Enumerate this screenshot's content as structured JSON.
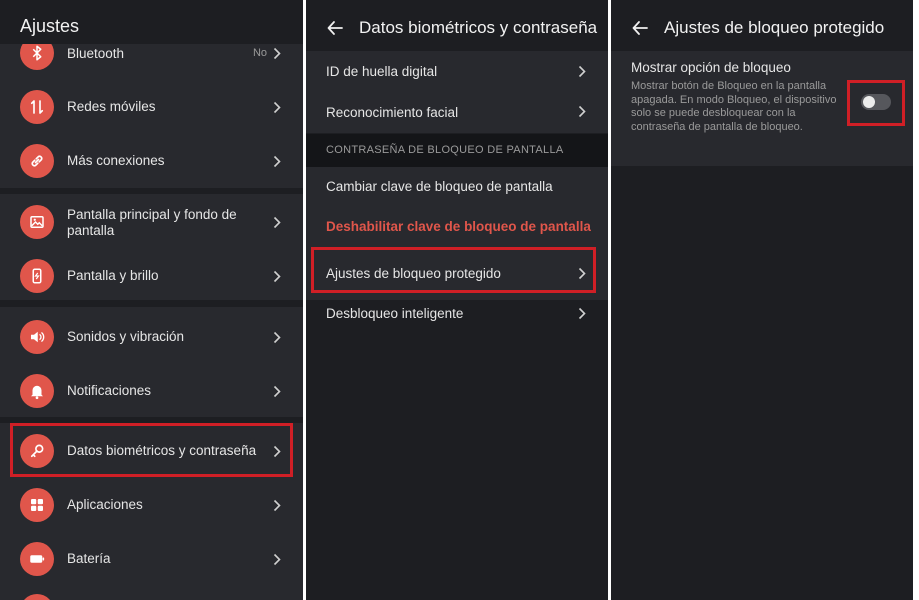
{
  "colors": {
    "accent": "#e0564b",
    "background": "#1d1e22",
    "highlight_border": "#d01f26"
  },
  "panel1": {
    "title": "Ajustes",
    "items": [
      {
        "label": "Bluetooth",
        "value": "No",
        "icon": "bluetooth-icon"
      },
      {
        "label": "Redes móviles",
        "icon": "mobile-data-icon"
      },
      {
        "label": "Más conexiones",
        "icon": "link-icon"
      },
      {
        "label": "Pantalla principal y fondo de pantalla",
        "icon": "image-icon"
      },
      {
        "label": "Pantalla y brillo",
        "icon": "phone-brightness-icon"
      },
      {
        "label": "Sonidos y vibración",
        "icon": "speaker-icon"
      },
      {
        "label": "Notificaciones",
        "icon": "bell-icon"
      },
      {
        "label": "Datos biométricos y contraseña",
        "icon": "key-icon"
      },
      {
        "label": "Aplicaciones",
        "icon": "apps-grid-icon"
      },
      {
        "label": "Batería",
        "icon": "battery-icon"
      }
    ]
  },
  "panel2": {
    "title": "Datos biométricos y contraseña",
    "items": [
      {
        "label": "ID de huella digital"
      },
      {
        "label": "Reconocimiento facial"
      }
    ],
    "section_header": "CONTRASEÑA DE BLOQUEO DE PANTALLA",
    "section_items": [
      {
        "label": "Cambiar clave de bloqueo de pantalla"
      },
      {
        "label": "Deshabilitar clave de bloqueo de pantalla"
      },
      {
        "label": "Ajustes de bloqueo protegido"
      },
      {
        "label": "Desbloqueo inteligente"
      }
    ]
  },
  "panel3": {
    "title": "Ajustes de bloqueo protegido",
    "option_title": "Mostrar opción de bloqueo",
    "option_description": "Mostrar botón de Bloqueo en la pantalla apagada. En modo Bloqueo, el dispositivo solo se puede desbloquear con la contraseña de pantalla de bloqueo.",
    "toggle_on": false
  }
}
